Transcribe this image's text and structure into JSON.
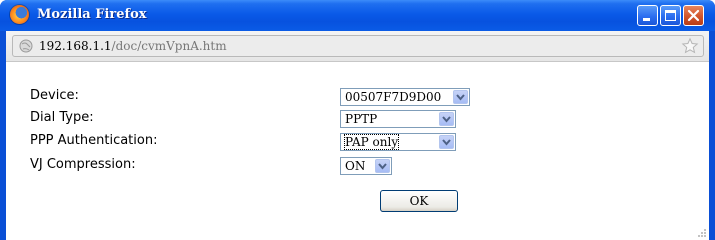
{
  "window": {
    "title": "Mozilla Firefox",
    "buttons": {
      "minimize_icon": "minimize-icon",
      "maximize_icon": "maximize-icon",
      "close_icon": "close-icon"
    }
  },
  "urlbar": {
    "host": "192.168.1.1",
    "path": "/doc/cvmVpnA.htm",
    "left_icon": "globe-icon",
    "right_icon": "bookmark-star-icon"
  },
  "form": {
    "device": {
      "label": "Device:",
      "value": "00507F7D9D00"
    },
    "dial_type": {
      "label": "Dial Type:",
      "value": "PPTP"
    },
    "ppp_auth": {
      "label": "PPP Authentication:",
      "value": "PAP only"
    },
    "vj": {
      "label": "VJ Compression:",
      "value": "ON"
    },
    "ok_label": "OK"
  },
  "colors": {
    "titlebar": "#0a5ae8",
    "close_button": "#d2552c",
    "select_border": "#7f9db9"
  }
}
